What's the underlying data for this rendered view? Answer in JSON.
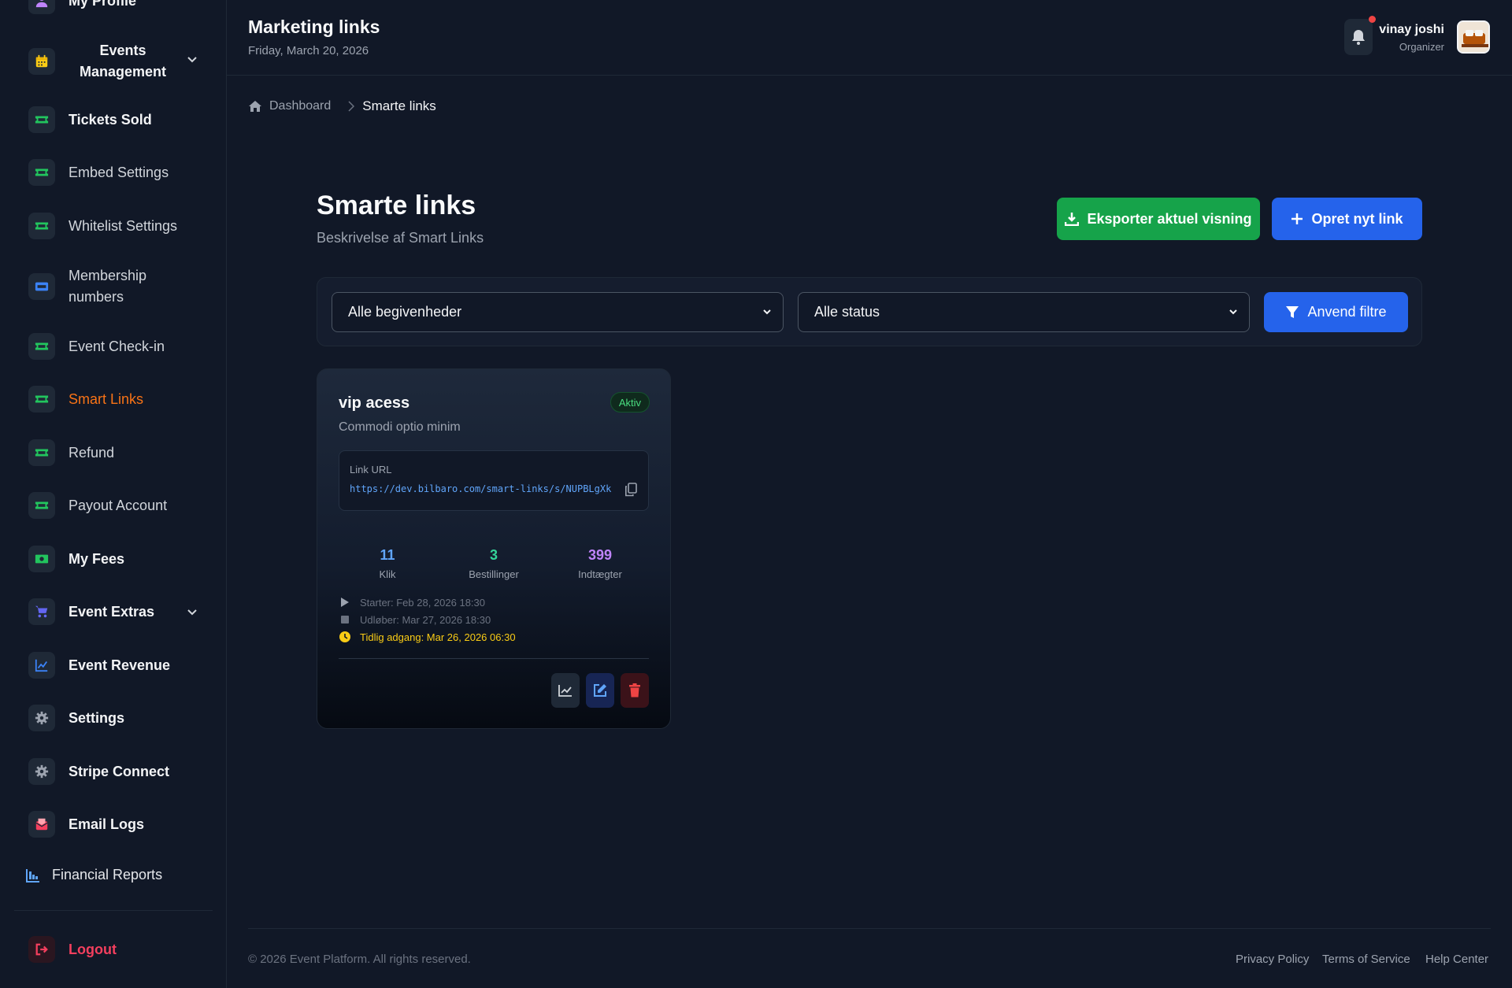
{
  "header": {
    "title": "Marketing links",
    "date": "Friday, March 20, 2026",
    "user_name": "vinay joshi",
    "user_role": "Organizer"
  },
  "sidebar": {
    "items": [
      {
        "label": "My Profile",
        "icon": "user-icon"
      },
      {
        "label": "Events Management",
        "icon": "calendar-icon",
        "expandable": true
      },
      {
        "label": "Tickets Sold",
        "icon": "ticket-icon"
      },
      {
        "label": "Embed Settings",
        "icon": "ticket-icon"
      },
      {
        "label": "Whitelist Settings",
        "icon": "ticket-icon"
      },
      {
        "label": "Membership numbers",
        "icon": "id-card-icon"
      },
      {
        "label": "Event Check-in",
        "icon": "ticket-icon"
      },
      {
        "label": "Smart Links",
        "icon": "ticket-icon",
        "active": true
      },
      {
        "label": "Refund",
        "icon": "ticket-icon"
      },
      {
        "label": "Payout Account",
        "icon": "ticket-icon"
      },
      {
        "label": "My Fees",
        "icon": "money-icon"
      },
      {
        "label": "Event Extras",
        "icon": "cart-icon",
        "expandable": true
      },
      {
        "label": "Event Revenue",
        "icon": "chart-line-icon"
      },
      {
        "label": "Settings",
        "icon": "gear-icon"
      },
      {
        "label": "Stripe Connect",
        "icon": "gear-icon"
      },
      {
        "label": "Email Logs",
        "icon": "envelope-icon"
      },
      {
        "label": "Financial Reports",
        "icon": "chart-bar-icon"
      },
      {
        "label": "Logout",
        "icon": "logout-icon"
      }
    ]
  },
  "breadcrumb": {
    "home": "Dashboard",
    "current": "Smarte links"
  },
  "main": {
    "title": "Smarte links",
    "subtitle": "Beskrivelse af Smart Links",
    "export_label": "Eksporter aktuel visning",
    "new_label": "Opret nyt link"
  },
  "filters": {
    "event_selected": "Alle begivenheder",
    "status_selected": "Alle status",
    "apply_label": "Anvend filtre"
  },
  "card": {
    "title": "vip acess",
    "status": "Aktiv",
    "description": "Commodi optio minim",
    "link_label": "Link URL",
    "link_url": "https://dev.bilbaro.com/smart-links/s/NUPBLgXk",
    "stats": [
      {
        "value": "11",
        "label": "Klik",
        "color": "#60a5fa"
      },
      {
        "value": "3",
        "label": "Bestillinger",
        "color": "#34d399"
      },
      {
        "value": "399",
        "label": "Indtægter",
        "color": "#c084fc"
      }
    ],
    "starts": "Starter: Feb 28, 2026 18:30",
    "expires": "Udløber: Mar 27, 2026 18:30",
    "early_access": "Tidlig adgang: Mar 26, 2026 06:30"
  },
  "footer": {
    "copyright": "© 2026 Event Platform. All rights reserved.",
    "links": [
      "Privacy Policy",
      "Terms of Service",
      "Help Center"
    ]
  },
  "colors": {
    "background": "#111827",
    "active_nav": "#f97316",
    "primary": "#2563eb",
    "success": "#16a34a",
    "danger": "#ef4444"
  }
}
